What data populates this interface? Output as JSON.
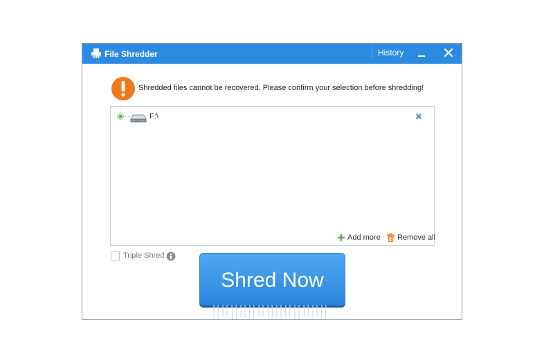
{
  "window": {
    "title": "File Shredder",
    "history_label": "History",
    "accent_color": "#2b8be0"
  },
  "warning": {
    "text": "Shredded files cannot be recovered. Please confirm your selection before shredding!",
    "icon_color": "#f07818"
  },
  "file_list": {
    "items": [
      {
        "label": "F:\\",
        "icon": "drive-icon",
        "selected": true
      }
    ],
    "add_more_label": "Add more",
    "remove_all_label": "Remove all"
  },
  "options": {
    "triple_shred_label": "Triple Shred",
    "triple_shred_checked": false
  },
  "shred_button": {
    "label": "Shred Now"
  }
}
